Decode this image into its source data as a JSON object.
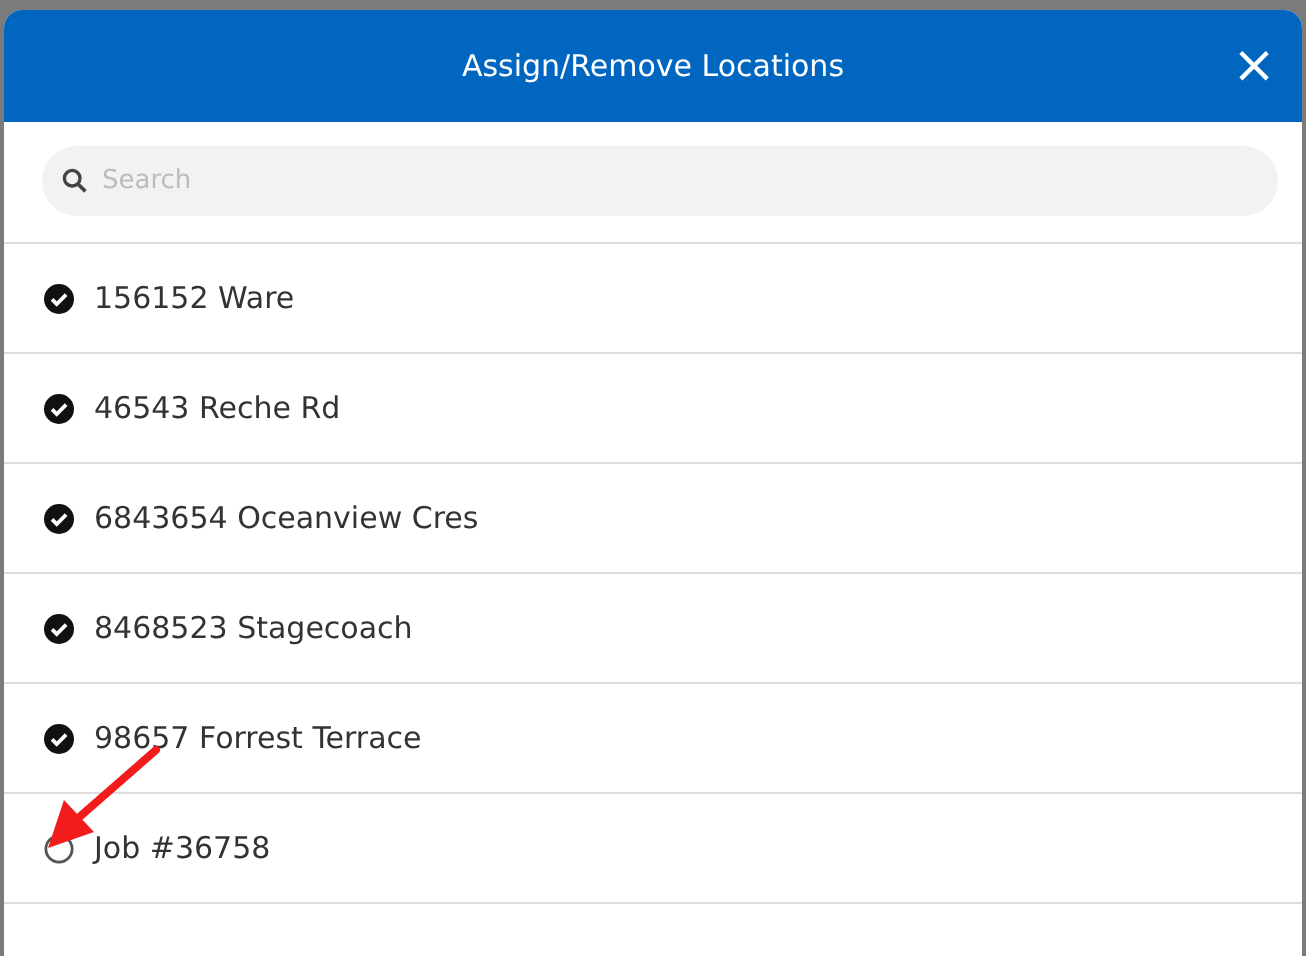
{
  "dialog": {
    "title": "Assign/Remove Locations",
    "close_label": "×"
  },
  "search": {
    "placeholder": "Search"
  },
  "locations": [
    {
      "name": "156152 Ware",
      "checked": true
    },
    {
      "name": "46543 Reche Rd",
      "checked": true
    },
    {
      "name": "6843654 Oceanview Cres",
      "checked": true
    },
    {
      "name": "8468523 Stagecoach",
      "checked": true
    },
    {
      "name": "98657 Forrest Terrace",
      "checked": true
    },
    {
      "name": "Job #36758",
      "checked": false
    }
  ]
}
